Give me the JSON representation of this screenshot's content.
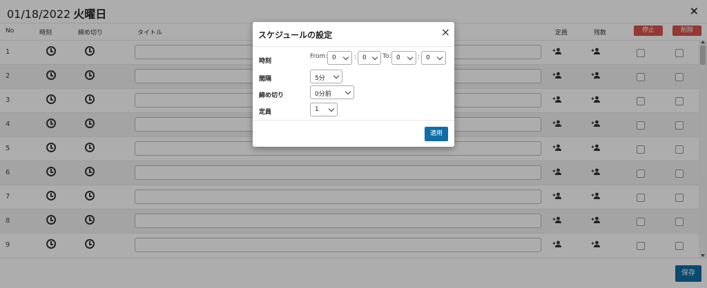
{
  "header": {
    "date": "01/18/2022",
    "weekday": "火曜日",
    "close_symbol": "×"
  },
  "table": {
    "columns": {
      "no": "No",
      "time": "時刻",
      "deadline": "締め切り",
      "title": "タイトル",
      "capacity": "定員",
      "remaining": "残数",
      "stop": "停止",
      "delete": "削除"
    },
    "rows": [
      {
        "no": "1"
      },
      {
        "no": "2"
      },
      {
        "no": "3"
      },
      {
        "no": "4"
      },
      {
        "no": "5"
      },
      {
        "no": "6"
      },
      {
        "no": "7"
      },
      {
        "no": "8"
      },
      {
        "no": "9"
      }
    ]
  },
  "footer": {
    "save_label": "保存"
  },
  "modal": {
    "title": "スケジュールの設定",
    "close_symbol": "×",
    "time_label": "時刻",
    "from_label": "From:",
    "to_label": "To:",
    "colon": ":",
    "from_hour": "0",
    "from_minute": "0",
    "to_hour": "0",
    "to_minute": "0",
    "interval_label": "間隔",
    "interval_value": "5分",
    "deadline_label": "締め切り",
    "deadline_value": "0分前",
    "capacity_label": "定員",
    "capacity_value": "1",
    "apply_label": "適用"
  },
  "colors": {
    "primary": "#0f6ea3",
    "danger": "#d9534f"
  },
  "icons": [
    "clock-icon",
    "add-person-icon",
    "close-icon",
    "chevron-down-icon"
  ]
}
